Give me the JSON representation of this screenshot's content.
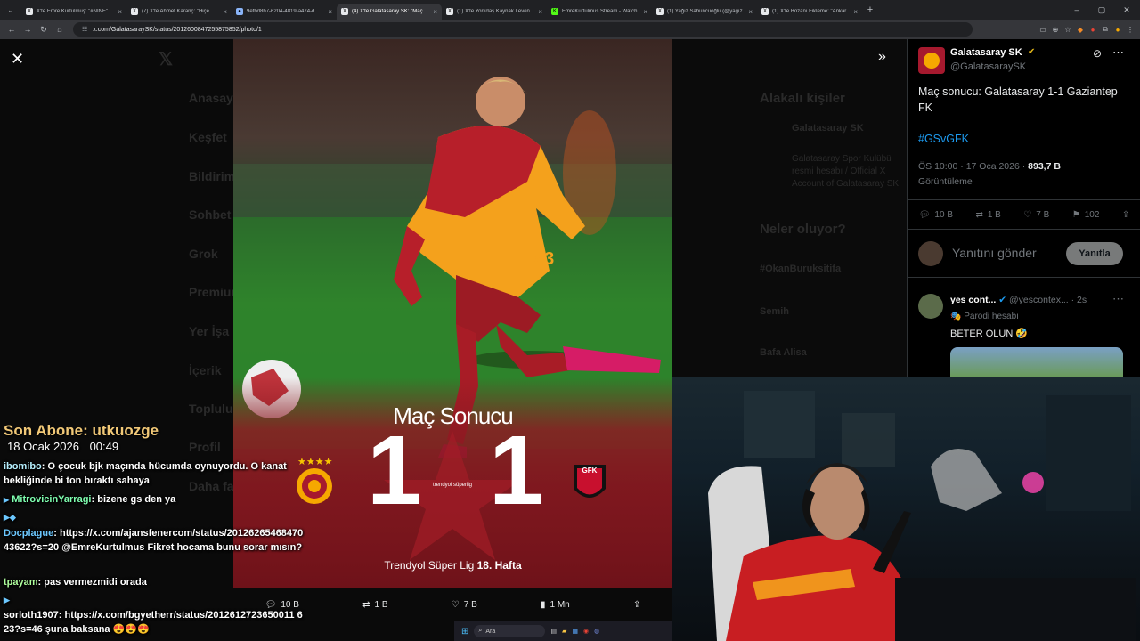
{
  "browser": {
    "tabs": [
      {
        "label": "X'te Emre Kurtulmuş: \"#NİNE\"",
        "active": false
      },
      {
        "label": "(7) X'te Ahmet Karanç: \"Hiçe",
        "active": false
      },
      {
        "label": "9efbd8b7-6204-4819-a474-d",
        "active": false
      },
      {
        "label": "(4) X'te Galatasaray SK: \"Maç so",
        "active": true
      },
      {
        "label": "(1) X'te Yorkdaş Kaynak Leven",
        "active": false
      },
      {
        "label": "EmreKurtulmus Stream - Watch",
        "active": false
      },
      {
        "label": "(1) Yağız Sabuncuoğlu (@yagız",
        "active": false
      },
      {
        "label": "(1) X'te Bozanı Fikleme: \"Ankar",
        "active": false
      }
    ],
    "url": "x.com/GalatasaraySK/status/2012600847255875852/photo/1"
  },
  "background_nav": [
    "Anasayfa",
    "Keşfet",
    "Bildirim",
    "Sohbet",
    "Grok",
    "Premium",
    "Yer İşa",
    "İçerik",
    "Topluluk",
    "Profil",
    "Daha fazla"
  ],
  "background_side": {
    "related_title": "Alakalı kişiler",
    "account_name": "Galatasaray SK",
    "account_bio": "Galatasaray Spor Kulübü resmi hesabı / Official X Account of Galatasaray SK",
    "whats_title": "Neler oluyor?",
    "trend": "#OkanBuruksitifa",
    "trend2": "Semih",
    "trend3": "Bafa Alisa"
  },
  "photo": {
    "title": "Maç Sonucu",
    "home_score": "1",
    "away_score": "1",
    "league_logo_text": "trendyol süperlig",
    "footer": "Trendyol Süper Lig",
    "week": "18. Hafta",
    "away_badge": "GFK",
    "jersey_number": "53"
  },
  "photo_actions": {
    "replies": "10 B",
    "retweets": "1 B",
    "likes": "7 B",
    "views": "1 Mn"
  },
  "tweet": {
    "author_name": "Galatasaray SK",
    "author_handle": "@GalatasaraySK",
    "text": "Maç sonucu: Galatasaray 1-1 Gaziantep FK",
    "hashtag": "#GSvGFK",
    "time": "ÖS 10:00 · 17 Oca 2026 · ",
    "views_count": "893,7 B",
    "views_label": "Görüntüleme",
    "replies": "10 B",
    "retweets": "1 B",
    "likes": "7 B",
    "bookmarks": "102",
    "reply_placeholder": "Yanıtını gönder",
    "reply_button": "Yanıtla"
  },
  "reply": {
    "name": "yes cont...",
    "handle": "@yescontex...",
    "age": "· 2s",
    "label": "Parodi hesabı",
    "text": "BETER OLUN 🤣"
  },
  "stream_overlay": {
    "last_sub_label": "Son Abone: utkuozge",
    "date": "18 Ocak 2026",
    "time": "00:49"
  },
  "chat": [
    {
      "user": "ibomibo",
      "msg": "O çocuk bjk maçında hücumda oynuyordu. O kanat bekliğinde bi ton bıraktı sahaya",
      "color": "#b6f0ff"
    },
    {
      "user": "MitrovicinYarragi",
      "msg": "bizene gs den ya",
      "color": "#7fffb0"
    },
    {
      "user": "Docplague",
      "msg": "https://x.com/ajansfenercom/status/2012626546847043622?s=20 @EmreKurtulmus Fikret hocama bunu sorar mısın?",
      "color": "#6cc8ff"
    },
    {
      "user": "tpayam",
      "msg": "pas vermezmidi orada",
      "color": "#b0ff9e"
    },
    {
      "user": "sorloth1907",
      "msg": "https://x.com/bgyetherr/status/2012612723650011 623?s=46 şuna baksana 😍😍😍",
      "color": "#ffffff"
    }
  ],
  "taskbar": {
    "search_placeholder": "Ara"
  },
  "colors": {
    "accent": "#1d9bf0",
    "gs_red": "#a6192e",
    "gs_yellow": "#f6a800"
  }
}
